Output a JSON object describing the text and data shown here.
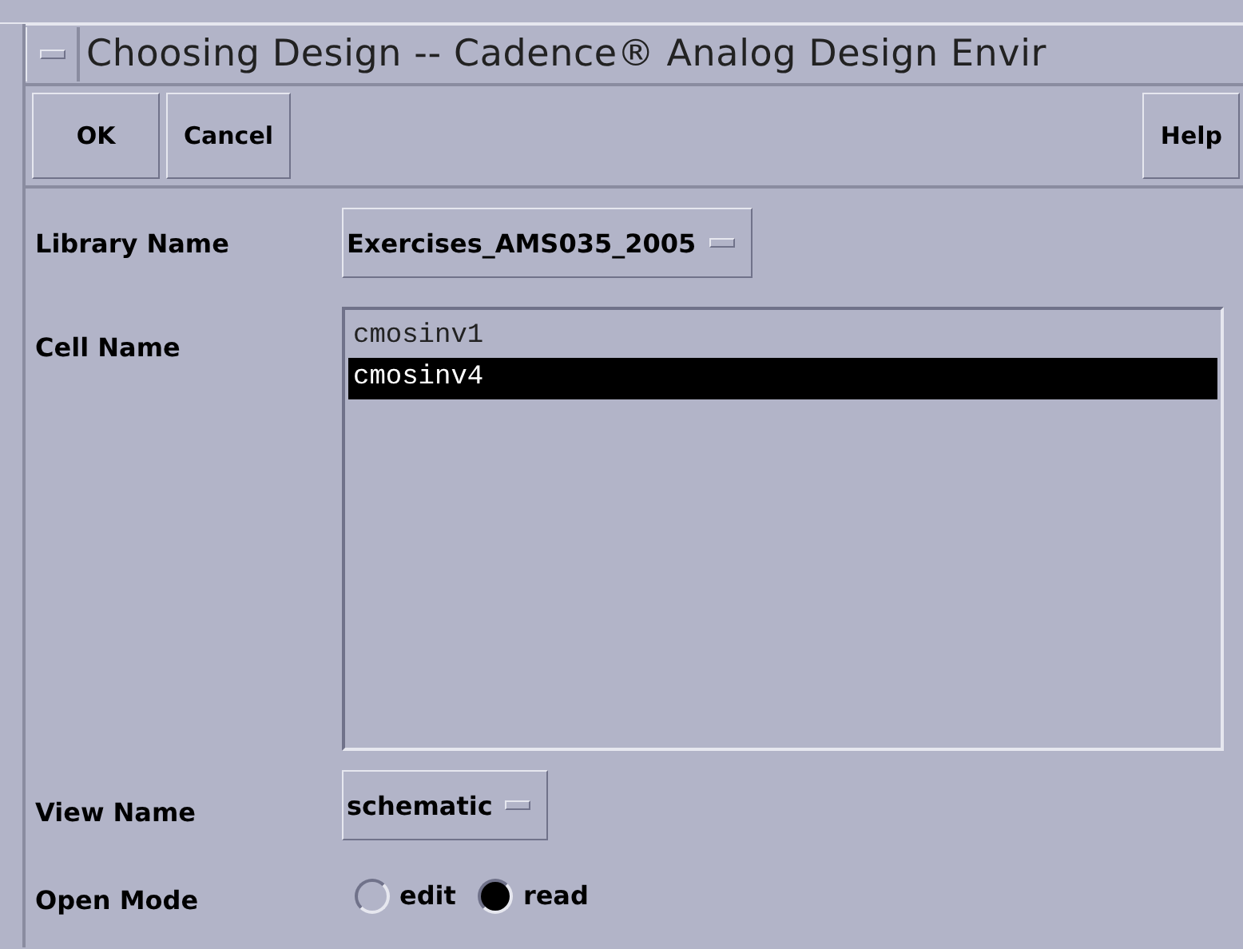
{
  "window": {
    "title": "Choosing Design -- Cadence® Analog Design Envir"
  },
  "buttons": [
    {
      "label": "OK",
      "kind": "left"
    },
    {
      "label": "Cancel",
      "kind": "left"
    },
    {
      "label": "Help",
      "kind": "right"
    }
  ],
  "library_name": {
    "label": "Library Name",
    "value": "Exercises_AMS035_2005"
  },
  "cell_name": {
    "label": "Cell Name",
    "items": [
      {
        "text": "cmosinv1",
        "selected": false
      },
      {
        "text": "cmosinv4",
        "selected": true
      }
    ]
  },
  "view_name": {
    "label": "View Name",
    "value": "schematic"
  },
  "open_mode": {
    "label": "Open Mode",
    "options": [
      {
        "label": "edit",
        "selected": false
      },
      {
        "label": "read",
        "selected": true
      }
    ]
  }
}
